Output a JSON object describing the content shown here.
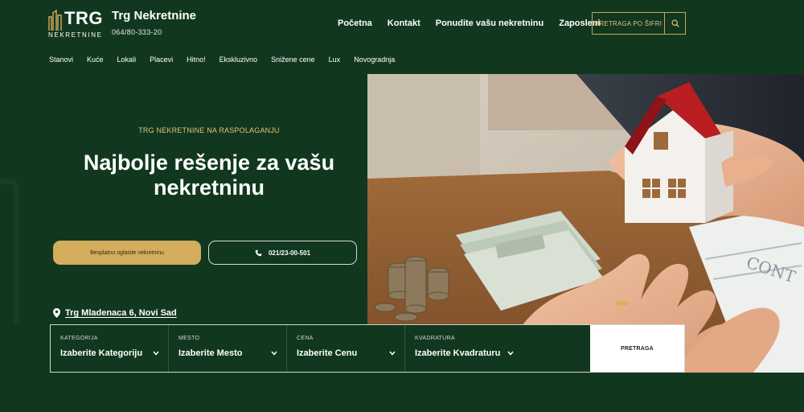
{
  "brand": {
    "logo_main": "TRG",
    "logo_sub": "NEKRETNINE",
    "name": "Trg Nekretnine",
    "phone": "064/80-333-20"
  },
  "nav": {
    "main": [
      "Početna",
      "Kontakt",
      "Ponudite vašu nekretninu",
      "Zaposleni"
    ],
    "code_search_label": "PRETRAGA PO ŠIFRI",
    "sub": [
      "Stanovi",
      "Kuće",
      "Lokali",
      "Placevi",
      "Hitno!",
      "Ekskluzivno",
      "Snižene cene",
      "Lux",
      "Novogradnja"
    ]
  },
  "hero": {
    "eyebrow": "TRG NEKRETNINE NA RASPOLAGANJU",
    "title": "Najbolje rešenje za vašu nekretninu",
    "cta_primary": "Besplatno oglasite nekretninu",
    "cta_phone": "021/23-00-501",
    "address": "Trg Mladenaca 6, Novi Sad"
  },
  "search": {
    "fields": [
      {
        "label": "KATEGORIJA",
        "value": "Izaberite Kategoriju"
      },
      {
        "label": "MESTO",
        "value": "Izaberite Mesto"
      },
      {
        "label": "CENA",
        "value": "Izaberite Cenu"
      },
      {
        "label": "KVADRATURA",
        "value": "Izaberite Kvadraturu"
      }
    ],
    "button": "PRETRAGA"
  },
  "colors": {
    "background": "#11381f",
    "accent_gold": "#d4ad5d",
    "text": "#ffffff"
  },
  "icons": [
    "logo-buildings-icon",
    "search-icon",
    "phone-icon",
    "location-pin-icon",
    "chevron-down-icon"
  ]
}
